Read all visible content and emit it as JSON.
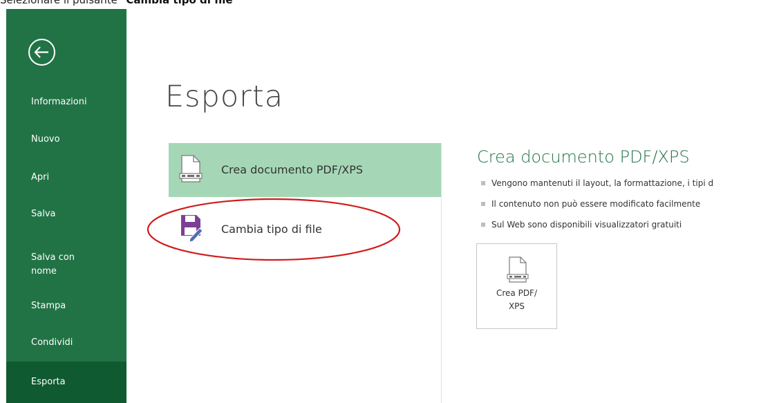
{
  "caption": {
    "prefix": "Selezionare il pulsante ",
    "bold": "\"Cambia tipo di file\""
  },
  "sidebar": {
    "items": [
      {
        "label": "Informazioni"
      },
      {
        "label": "Nuovo"
      },
      {
        "label": "Apri"
      },
      {
        "label": "Salva"
      },
      {
        "label": "Salva con nome"
      },
      {
        "label": "Stampa"
      },
      {
        "label": "Condividi"
      },
      {
        "label": "Esporta"
      }
    ],
    "selected": "Esporta"
  },
  "main": {
    "title": "Esporta",
    "options": [
      {
        "label": "Crea documento PDF/XPS",
        "icon": "pdf-document-icon"
      },
      {
        "label": "Cambia tipo di file",
        "icon": "save-as-icon"
      }
    ]
  },
  "panel": {
    "title": "Crea documento PDF/XPS",
    "bullets": [
      "Vengono mantenuti il layout, la formattazione, i tipi d",
      "Il contenuto non può essere modificato facilmente",
      "Sul Web sono disponibili visualizzatori gratuiti"
    ],
    "button_label_line1": "Crea PDF/",
    "button_label_line2": "XPS"
  },
  "colors": {
    "sidebar": "#217346",
    "sidebar_selected": "#0f5a30",
    "option_highlight": "#a5d7b6",
    "annotation": "#d11a1a"
  }
}
